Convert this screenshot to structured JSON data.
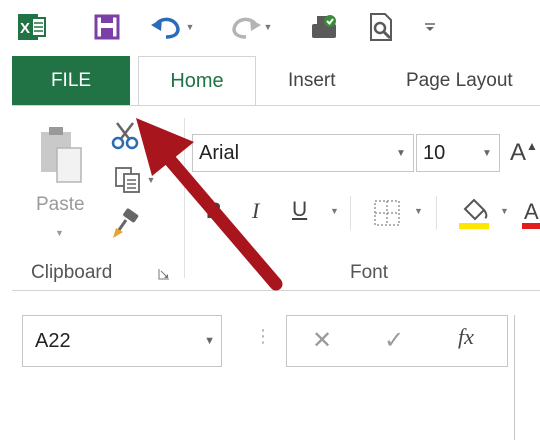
{
  "colors": {
    "file_tab": "#217346",
    "home_text": "#217346",
    "annotation_arrow": "#a8151c",
    "fill_bar": "#ffe600",
    "font_color_bar": "#e01e1e"
  },
  "quick_access": {
    "icons": [
      "excel-logo-icon",
      "save-icon",
      "undo-icon",
      "redo-icon",
      "touch-mode-icon",
      "print-preview-icon",
      "customize-qat-icon"
    ],
    "excel_logo_letter": "X"
  },
  "tabs": [
    {
      "label": "FILE"
    },
    {
      "label": "Home"
    },
    {
      "label": "Insert"
    },
    {
      "label": "Page Layout"
    }
  ],
  "clipboard": {
    "paste_label": "Paste",
    "group_label": "Clipboard",
    "icons": [
      "paste-icon",
      "cut-icon",
      "copy-icon",
      "format-painter-icon",
      "dialog-launcher-icon"
    ]
  },
  "font": {
    "font_name": "Arial",
    "font_size": "10",
    "grow_font_glyph": "A",
    "bold_glyph": "B",
    "italic_glyph": "I",
    "underline_glyph": "U",
    "group_label": "Font"
  },
  "formula_bar": {
    "name_box_value": "A22",
    "cancel_glyph": "✕",
    "enter_glyph": "✓",
    "fx_glyph": "fx"
  }
}
